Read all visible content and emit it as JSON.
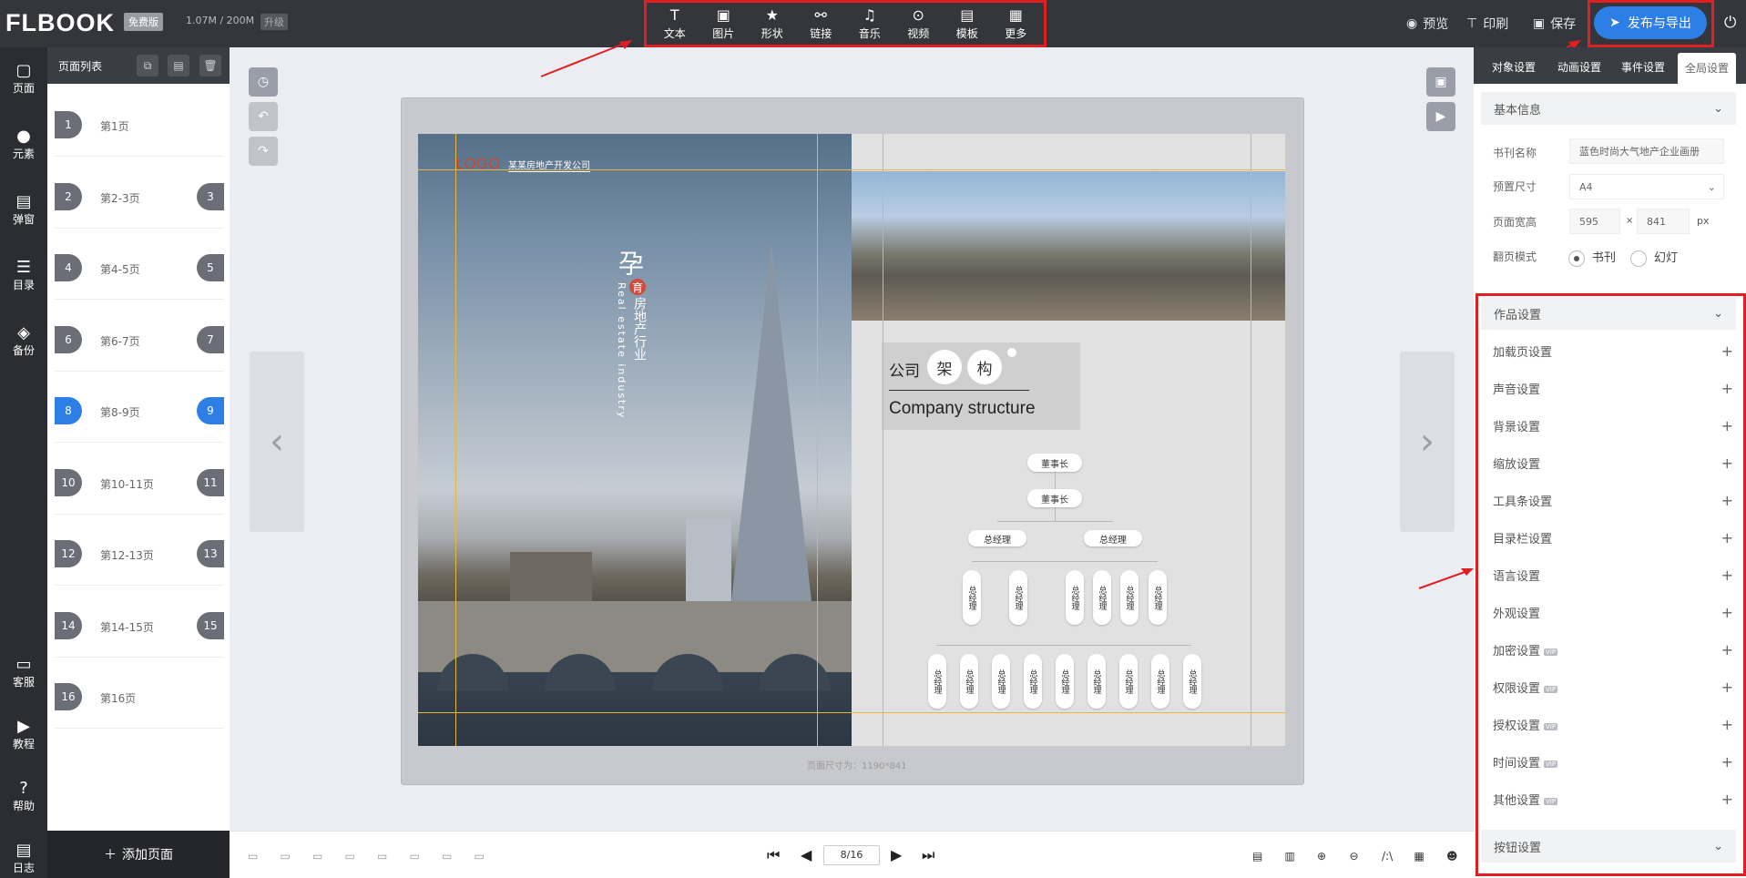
{
  "app": {
    "logo": "FLBOOK",
    "plan_badge": "免费版",
    "storage": "1.07M / 200M",
    "upgrade": "升级"
  },
  "toolbar": [
    {
      "icon": "text-icon",
      "glyph": "T",
      "label": "文本"
    },
    {
      "icon": "image-icon",
      "glyph": "▣",
      "label": "图片"
    },
    {
      "icon": "star-icon",
      "glyph": "★",
      "label": "形状"
    },
    {
      "icon": "link-icon",
      "glyph": "⚯",
      "label": "链接"
    },
    {
      "icon": "music-icon",
      "glyph": "♫",
      "label": "音乐"
    },
    {
      "icon": "video-icon",
      "glyph": "⊙",
      "label": "视频"
    },
    {
      "icon": "template-icon",
      "glyph": "▤",
      "label": "模板"
    },
    {
      "icon": "more-icon",
      "glyph": "▦",
      "label": "更多"
    }
  ],
  "top_actions": {
    "preview": "预览",
    "print": "印刷",
    "save": "保存",
    "publish": "发布与导出"
  },
  "rail": [
    {
      "icon": "page-icon",
      "glyph": "▢",
      "label": "页面"
    },
    {
      "icon": "element-icon",
      "glyph": "●",
      "label": "元素"
    },
    {
      "icon": "popup-icon",
      "glyph": "▤",
      "label": "弹窗"
    },
    {
      "icon": "toc-icon",
      "glyph": "☰",
      "label": "目录"
    },
    {
      "icon": "backup-icon",
      "glyph": "◈",
      "label": "备份"
    },
    {
      "icon": "service-icon",
      "glyph": "▭",
      "label": "客服"
    },
    {
      "icon": "tutorial-icon",
      "glyph": "▶",
      "label": "教程"
    },
    {
      "icon": "help-icon",
      "glyph": "?",
      "label": "帮助"
    },
    {
      "icon": "log-icon",
      "glyph": "▤",
      "label": "日志"
    }
  ],
  "pagelist": {
    "title": "页面列表",
    "items": [
      {
        "left": "1",
        "right": "",
        "label": "第1页",
        "active": false
      },
      {
        "left": "2",
        "right": "3",
        "label": "第2-3页",
        "active": false
      },
      {
        "left": "4",
        "right": "5",
        "label": "第4-5页",
        "active": false
      },
      {
        "left": "6",
        "right": "7",
        "label": "第6-7页",
        "active": false
      },
      {
        "left": "8",
        "right": "9",
        "label": "第8-9页",
        "active": true
      },
      {
        "left": "10",
        "right": "11",
        "label": "第10-11页",
        "active": false
      },
      {
        "left": "12",
        "right": "13",
        "label": "第12-13页",
        "active": false
      },
      {
        "left": "14",
        "right": "15",
        "label": "第14-15页",
        "active": false
      },
      {
        "left": "16",
        "right": "",
        "label": "第16页",
        "active": false
      }
    ],
    "add": "添加页面"
  },
  "canvas": {
    "page_size": "页面尺寸为：1190*841",
    "logo_text": "LOGO",
    "company": "某某房地产开发公司",
    "vertical_big": "孕",
    "vertical_badge": "育",
    "vertical_cn": "房地产行业",
    "vertical_en": "Real estate industry",
    "structure_cn": [
      "公司",
      "架",
      "构"
    ],
    "structure_en": "Company structure",
    "org": {
      "top": [
        "董事长",
        "董事长"
      ],
      "mid": [
        "总经理",
        "总经理"
      ],
      "third": [
        "总经理",
        "总经理",
        "总经理",
        "总经理",
        "总经理",
        "总经理"
      ],
      "bottom": [
        "总经理",
        "总经理",
        "总经理",
        "总经理",
        "总经理",
        "总经理",
        "总经理",
        "总经理",
        "总经理"
      ]
    }
  },
  "bottom": {
    "page_indicator": "8/16"
  },
  "right_panel": {
    "tabs": [
      "对象设置",
      "动画设置",
      "事件设置",
      "全局设置"
    ],
    "basic": {
      "title": "基本信息",
      "name_label": "书刊名称",
      "name_value": "蓝色时尚大气地产企业画册",
      "preset_label": "预置尺寸",
      "preset_value": "A4",
      "size_label": "页面宽高",
      "width": "595",
      "height": "841",
      "unit": "px",
      "times": "×",
      "mode_label": "翻页模式",
      "mode_book": "书刊",
      "mode_slide": "幻灯"
    },
    "work_settings": "作品设置",
    "items": [
      {
        "label": "加载页设置",
        "vip": false
      },
      {
        "label": "声音设置",
        "vip": false
      },
      {
        "label": "背景设置",
        "vip": false
      },
      {
        "label": "缩放设置",
        "vip": false
      },
      {
        "label": "工具条设置",
        "vip": false
      },
      {
        "label": "目录栏设置",
        "vip": false
      },
      {
        "label": "语言设置",
        "vip": false
      },
      {
        "label": "外观设置",
        "vip": false
      },
      {
        "label": "加密设置",
        "vip": true
      },
      {
        "label": "权限设置",
        "vip": true
      },
      {
        "label": "授权设置",
        "vip": true
      },
      {
        "label": "时间设置",
        "vip": true
      },
      {
        "label": "其他设置",
        "vip": true
      }
    ],
    "button_settings": "按钮设置",
    "vip_badge": "VIP"
  },
  "colors": {
    "accent": "#2d7fe6",
    "highlight": "#e02020",
    "topbar": "#34363c"
  }
}
